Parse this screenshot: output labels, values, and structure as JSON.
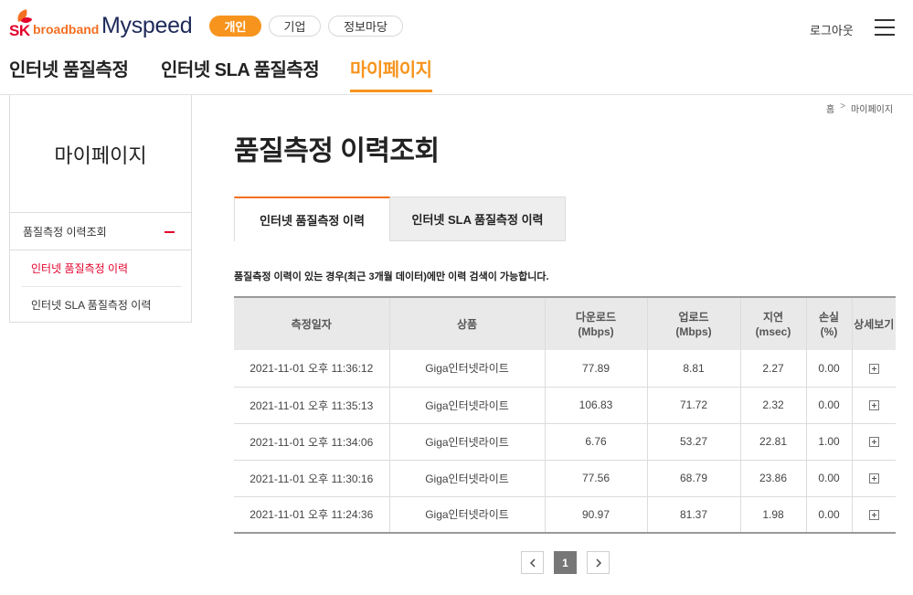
{
  "header": {
    "logo": {
      "sk": "SK",
      "broadband": "broadband"
    },
    "brand": "Myspeed",
    "segments": {
      "personal": "개인",
      "business": "기업",
      "info": "정보마당"
    },
    "logout": "로그아웃",
    "gnb": [
      "인터넷 품질측정",
      "인터넷 SLA 품질측정",
      "마이페이지"
    ]
  },
  "sidebar": {
    "title": "마이페이지",
    "group": "품질측정 이력조회",
    "items": [
      "인터넷 품질측정 이력",
      "인터넷 SLA 품질측정 이력"
    ]
  },
  "breadcrumb": {
    "home": "홈",
    "sep": ">",
    "current": "마이페이지"
  },
  "page_title": "품질측정 이력조회",
  "tabs": [
    "인터넷 품질측정 이력",
    "인터넷 SLA 품질측정 이력"
  ],
  "notice": "품질측정 이력이 있는 경우(최근 3개월 데이터)에만 이력 검색이 가능합니다.",
  "table": {
    "headers": [
      {
        "line1": "측정일자",
        "line2": ""
      },
      {
        "line1": "상품",
        "line2": ""
      },
      {
        "line1": "다운로드",
        "line2": "(Mbps)"
      },
      {
        "line1": "업로드",
        "line2": "(Mbps)"
      },
      {
        "line1": "지연",
        "line2": "(msec)"
      },
      {
        "line1": "손실",
        "line2": "(%)"
      },
      {
        "line1": "상세보기",
        "line2": ""
      }
    ],
    "rows": [
      {
        "date": "2021-11-01 오후 11:36:12",
        "product": "Giga인터넷라이트",
        "download": "77.89",
        "upload": "8.81",
        "latency": "2.27",
        "loss": "0.00"
      },
      {
        "date": "2021-11-01 오후 11:35:13",
        "product": "Giga인터넷라이트",
        "download": "106.83",
        "upload": "71.72",
        "latency": "2.32",
        "loss": "0.00"
      },
      {
        "date": "2021-11-01 오후 11:34:06",
        "product": "Giga인터넷라이트",
        "download": "6.76",
        "upload": "53.27",
        "latency": "22.81",
        "loss": "1.00"
      },
      {
        "date": "2021-11-01 오후 11:30:16",
        "product": "Giga인터넷라이트",
        "download": "77.56",
        "upload": "68.79",
        "latency": "23.86",
        "loss": "0.00"
      },
      {
        "date": "2021-11-01 오후 11:24:36",
        "product": "Giga인터넷라이트",
        "download": "90.97",
        "upload": "81.37",
        "latency": "1.98",
        "loss": "0.00"
      }
    ]
  },
  "pagination": {
    "current": "1"
  },
  "colors": {
    "accent": "#f7941d",
    "brand_red": "#e4002b",
    "brand_navy": "#1e2a5a"
  }
}
